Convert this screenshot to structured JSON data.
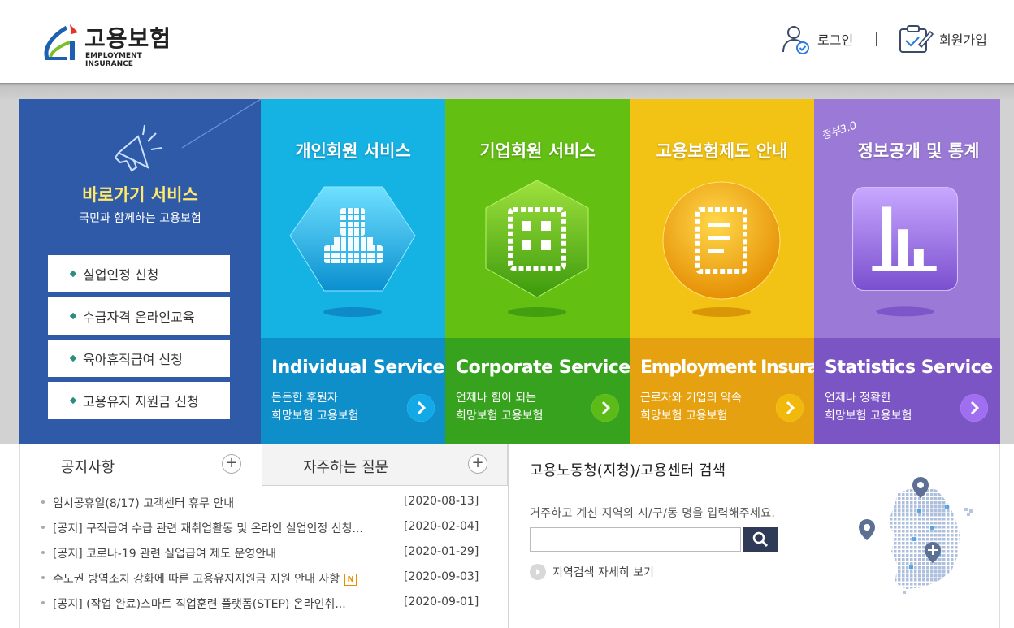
{
  "header": {
    "logo_title": "고용보험",
    "logo_sub": "EMPLOYMENT INSURANCE",
    "login_label": "로그인",
    "join_label": "회원가입"
  },
  "quick": {
    "title": "바로가기 서비스",
    "subtitle": "국민과 함께하는 고용보험",
    "items": [
      "실업인정 신청",
      "수급자격 온라인교육",
      "육아휴직급여 신청",
      "고용유지 지원금 신청"
    ]
  },
  "services": [
    {
      "title": "개인회원 서비스",
      "en": "Individual Service",
      "desc1": "든든한 후원자",
      "desc2": "희망보험 고용보험",
      "color": "#15b2e4",
      "dark": "#0e8fca",
      "icon": "person-icon"
    },
    {
      "title": "기업회원 서비스",
      "en": "Corporate Service",
      "desc1": "언제나 힘이 되는",
      "desc2": "희망보험 고용보험",
      "color": "#63bf12",
      "dark": "#37a21d",
      "icon": "building-icon"
    },
    {
      "title": "고용보험제도 안내",
      "en": "Employment Insurance",
      "desc1": "근로자와 기업의 약속",
      "desc2": "희망보험 고용보험",
      "color": "#f2c214",
      "dark": "#e6a110",
      "icon": "document-icon"
    },
    {
      "title": "정보공개 및 통계",
      "en": "Statistics Service",
      "desc1": "언제나 정확한",
      "desc2": "희망보험 고용보험",
      "badge": "정부3.0",
      "color": "#9a7ad6",
      "dark": "#7c55c4",
      "icon": "chart-icon"
    }
  ],
  "tabs": {
    "notice_label": "공지사항",
    "faq_label": "자주하는 질문"
  },
  "notices": [
    {
      "title": "임시공휴일(8/17) 고객센터 휴무 안내",
      "date": "[2020-08-13]",
      "badge": ""
    },
    {
      "title": "[공지] 구직급여 수급 관련 재취업활동 및 온라인 실업인정 신청...",
      "date": "[2020-02-04]",
      "badge": ""
    },
    {
      "title": "[공지] 코로나-19 관련 실업급여 제도 운영안내",
      "date": "[2020-01-29]",
      "badge": ""
    },
    {
      "title": "수도권 방역조치 강화에 따른 고용유지지원금 지원 안내 사항",
      "date": "[2020-09-03]",
      "badge": "N"
    },
    {
      "title": "[공지] (작업 완료)스마트 직업훈련 플랫폼(STEP) 온라인취...",
      "date": "[2020-09-01]",
      "badge": ""
    }
  ],
  "search": {
    "title": "고용노동청(지청)/고용센터 검색",
    "desc": "거주하고 계신 지역의 시/구/동 명을 입력해주세요.",
    "input_value": "",
    "detail_label": "지역검색 자세히 보기"
  }
}
